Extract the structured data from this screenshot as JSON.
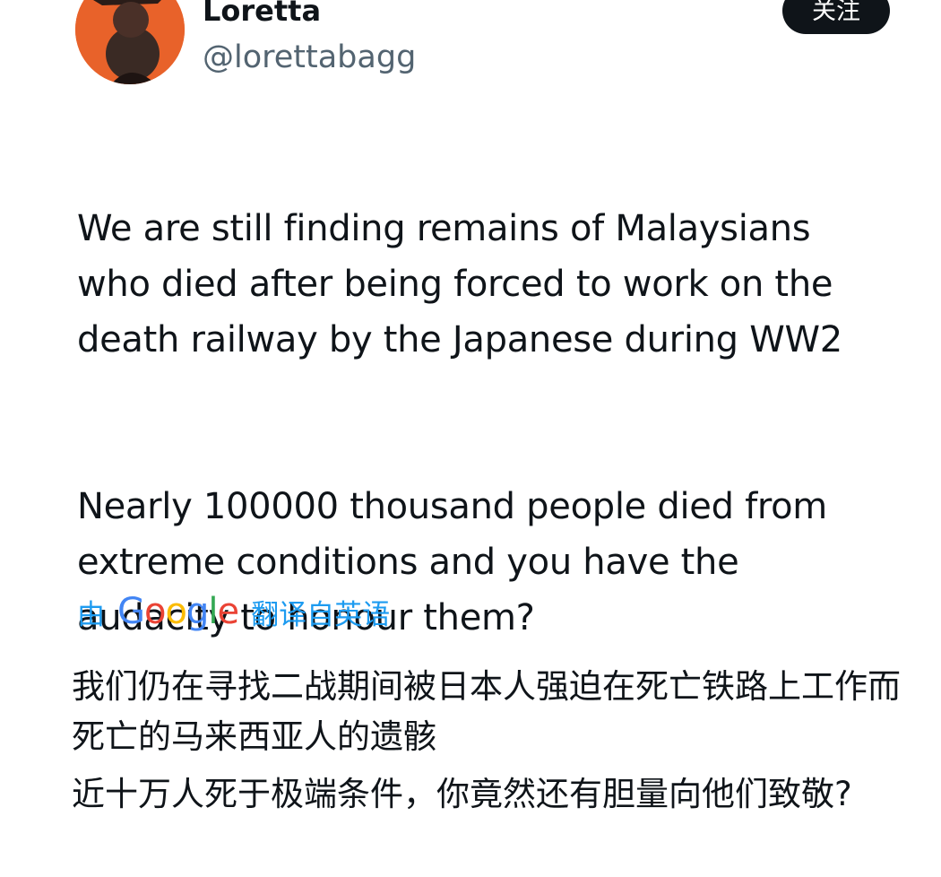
{
  "author": {
    "display_name": "Loretta",
    "handle": "@lorettabagg"
  },
  "follow_button": {
    "label": "关注"
  },
  "tweet": {
    "paragraphs": [
      "We are still finding remains of Malaysians\nwho died after being forced to work on the\ndeath railway by the Japanese during WW2",
      "Nearly 100000 thousand people died from\nextreme conditions and you have the\naudacity to honour them?"
    ]
  },
  "translation_notice": {
    "prefix": "由",
    "provider": "Google",
    "suffix": "翻译自英语"
  },
  "translation": {
    "paragraphs": [
      "我们仍在寻找二战期间被日本人强迫在死亡铁路上工作而死亡的马来西亚人的遗骸",
      "近十万人死于极端条件，你竟然还有胆量向他们致敬?"
    ]
  },
  "colors": {
    "accent": "#1d9bf0",
    "text": "#0f1419",
    "secondary": "#536471",
    "google_blue": "#4285f4",
    "google_red": "#ea4335",
    "google_yellow": "#fbbc05",
    "google_green": "#34a853"
  }
}
